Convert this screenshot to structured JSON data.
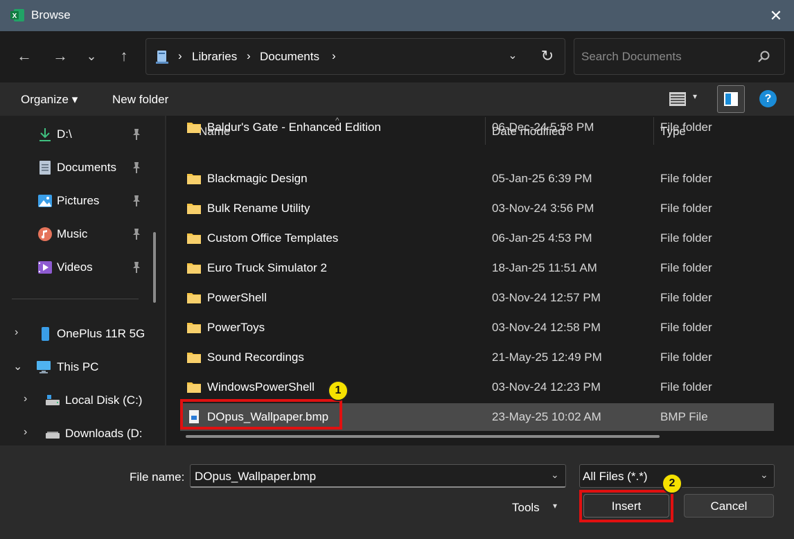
{
  "window": {
    "title": "Browse",
    "close_glyph": "✕",
    "app_icon": "excel-icon"
  },
  "nav": {
    "back": "←",
    "forward": "→",
    "recent": "⌄",
    "up": "↑"
  },
  "address": {
    "crumbs": [
      "Libraries",
      "Documents"
    ],
    "separator": "›",
    "dropdown": "⌄",
    "refresh": "↻"
  },
  "search": {
    "placeholder": "Search Documents"
  },
  "toolbar": {
    "organize": "Organize ▾",
    "new_folder": "New folder",
    "help": "?",
    "view_drop": "▾"
  },
  "sidebar": {
    "items": [
      {
        "label": "D:\\",
        "icon": "download-icon"
      },
      {
        "label": "Documents",
        "icon": "documents-icon"
      },
      {
        "label": "Pictures",
        "icon": "pictures-icon"
      },
      {
        "label": "Music",
        "icon": "music-icon"
      },
      {
        "label": "Videos",
        "icon": "videos-icon"
      },
      {
        "label": "OnePlus 11R 5G",
        "icon": "phone-icon"
      },
      {
        "label": "This PC",
        "icon": "pc-icon"
      },
      {
        "label": "Local Disk (C:)",
        "icon": "drive-icon"
      },
      {
        "label": "Downloads (D:",
        "icon": "drive-icon"
      }
    ],
    "pin_glyph": "📌",
    "chev_right": "›",
    "chev_down": "⌄"
  },
  "columns": {
    "name": "Name",
    "date": "Date modified",
    "type": "Type",
    "sort": "^"
  },
  "files": [
    {
      "name": "Baldur's Gate - Enhanced Edition",
      "date": "06-Dec-24 5:58 PM",
      "type": "File folder"
    },
    {
      "name": "Blackmagic Design",
      "date": "05-Jan-25 6:39 PM",
      "type": "File folder"
    },
    {
      "name": "Bulk Rename Utility",
      "date": "03-Nov-24 3:56 PM",
      "type": "File folder"
    },
    {
      "name": "Custom Office Templates",
      "date": "06-Jan-25 4:53 PM",
      "type": "File folder"
    },
    {
      "name": "Euro Truck Simulator 2",
      "date": "18-Jan-25 11:51 AM",
      "type": "File folder"
    },
    {
      "name": "PowerShell",
      "date": "03-Nov-24 12:57 PM",
      "type": "File folder"
    },
    {
      "name": "PowerToys",
      "date": "03-Nov-24 12:58 PM",
      "type": "File folder"
    },
    {
      "name": "Sound Recordings",
      "date": "21-May-25 12:49 PM",
      "type": "File folder"
    },
    {
      "name": "WindowsPowerShell",
      "date": "03-Nov-24 12:23 PM",
      "type": "File folder"
    },
    {
      "name": "DOpus_Wallpaper.bmp",
      "date": "23-May-25 10:02 AM",
      "type": "BMP File"
    }
  ],
  "footer": {
    "file_name_label": "File name:",
    "file_name_value": "DOpus_Wallpaper.bmp",
    "filter": "All Files (*.*)",
    "tools": "Tools",
    "insert": "Insert",
    "cancel": "Cancel",
    "drop": "⌄",
    "tools_drop": "▾"
  },
  "badges": {
    "one": "1",
    "two": "2"
  },
  "colors": {
    "highlight": "#e01010",
    "badge": "#f5e100",
    "folder": "#f5c443",
    "selection": "#4a4a4a"
  }
}
